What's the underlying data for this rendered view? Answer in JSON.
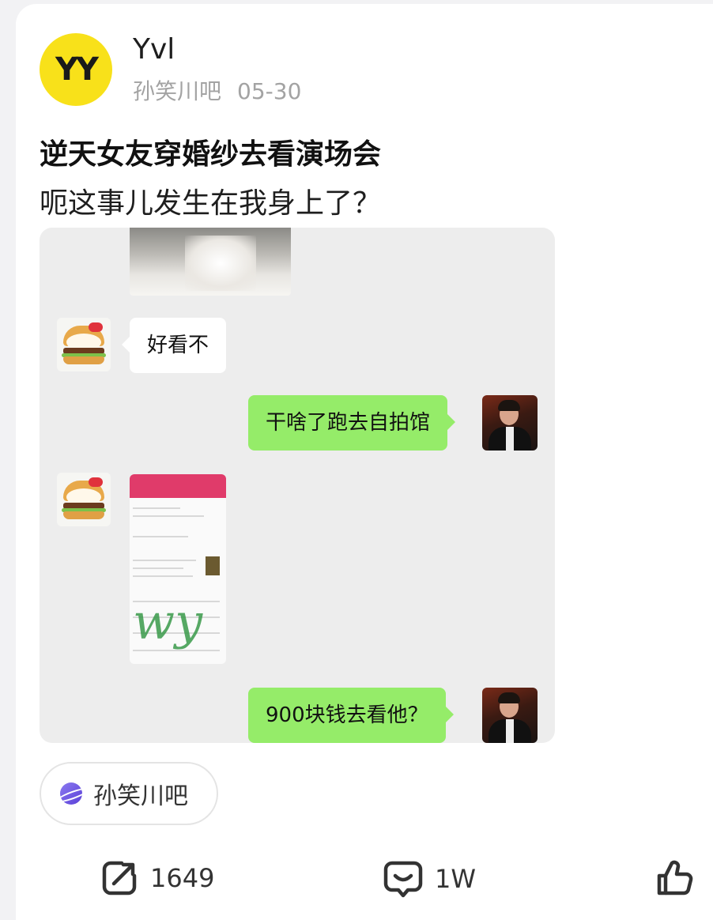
{
  "post": {
    "avatar_text": "YY",
    "username": "Yvl",
    "forum": "孙笑川吧",
    "date": "05-30",
    "title": "逆天女友穿婚纱去看演场会",
    "body": "呃这事儿发生在我身上了？"
  },
  "chat": {
    "messages": [
      {
        "side": "left",
        "text": "好看不"
      },
      {
        "side": "right",
        "text": "干啥了跑去自拍馆"
      },
      {
        "side": "right",
        "text": "900块钱去看他？"
      }
    ]
  },
  "tag": {
    "label": "孙笑川吧"
  },
  "actions": {
    "share_count": "1649",
    "comment_count": "1W"
  },
  "colors": {
    "avatar_bg": "#f8e11a",
    "bubble_right": "#95ec69",
    "bubble_left": "#ffffff",
    "chat_bg": "#ededed"
  }
}
